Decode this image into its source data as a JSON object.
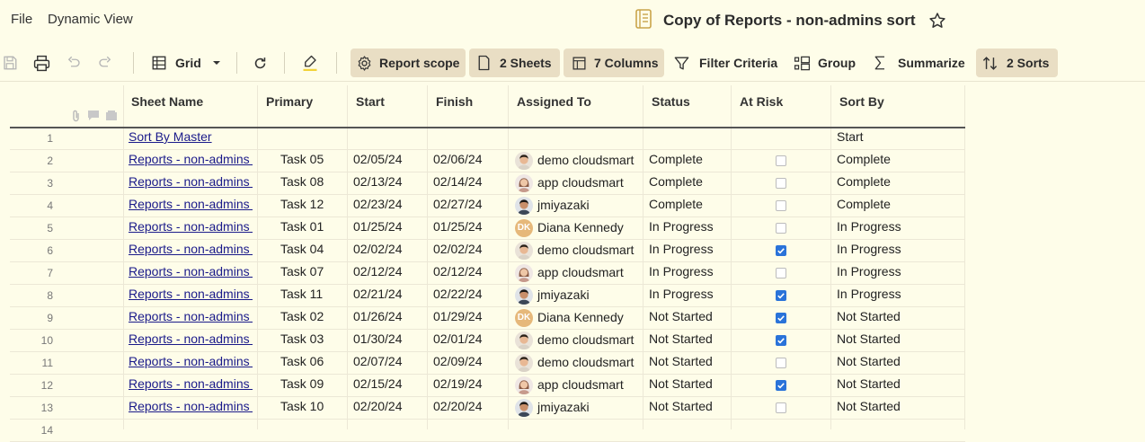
{
  "menu": {
    "file": "File",
    "dynamic_view": "Dynamic View"
  },
  "title": "Copy of Reports - non-admins sort",
  "toolbar": {
    "grid_label": "Grid",
    "report_scope": "Report scope",
    "sheets": "2 Sheets",
    "columns": "7 Columns",
    "filter": "Filter Criteria",
    "group": "Group",
    "summarize": "Summarize",
    "sorts": "2 Sorts"
  },
  "columns": {
    "sheet_name": "Sheet Name",
    "primary": "Primary",
    "start": "Start",
    "finish": "Finish",
    "assigned_to": "Assigned To",
    "status": "Status",
    "at_risk": "At Risk",
    "sort_by": "Sort By"
  },
  "rows": [
    {
      "num": "1",
      "sheet": "Sort By Master",
      "primary": "",
      "start": "",
      "finish": "",
      "assigned": "",
      "avatar": "",
      "status": "",
      "at_risk": null,
      "sort_by": "Start"
    },
    {
      "num": "2",
      "sheet": "Reports - non-admins s",
      "primary": "Task 05",
      "start": "02/05/24",
      "finish": "02/06/24",
      "assigned": "demo cloudsmart",
      "avatar": "man",
      "status": "Complete",
      "at_risk": false,
      "sort_by": "Complete"
    },
    {
      "num": "3",
      "sheet": "Reports - non-admins s",
      "primary": "Task 08",
      "start": "02/13/24",
      "finish": "02/14/24",
      "assigned": "app cloudsmart",
      "avatar": "woman",
      "status": "Complete",
      "at_risk": false,
      "sort_by": "Complete"
    },
    {
      "num": "4",
      "sheet": "Reports - non-admins s",
      "primary": "Task 12",
      "start": "02/23/24",
      "finish": "02/27/24",
      "assigned": "jmiyazaki",
      "avatar": "man-dark",
      "status": "Complete",
      "at_risk": false,
      "sort_by": "Complete"
    },
    {
      "num": "5",
      "sheet": "Reports - non-admins s",
      "primary": "Task 01",
      "start": "01/25/24",
      "finish": "01/25/24",
      "assigned": "Diana Kennedy",
      "avatar": "DK",
      "status": "In Progress",
      "at_risk": false,
      "sort_by": "In Progress"
    },
    {
      "num": "6",
      "sheet": "Reports - non-admins s",
      "primary": "Task 04",
      "start": "02/02/24",
      "finish": "02/02/24",
      "assigned": "demo cloudsmart",
      "avatar": "man",
      "status": "In Progress",
      "at_risk": true,
      "sort_by": "In Progress"
    },
    {
      "num": "7",
      "sheet": "Reports - non-admins s",
      "primary": "Task 07",
      "start": "02/12/24",
      "finish": "02/12/24",
      "assigned": "app cloudsmart",
      "avatar": "woman",
      "status": "In Progress",
      "at_risk": false,
      "sort_by": "In Progress"
    },
    {
      "num": "8",
      "sheet": "Reports - non-admins s",
      "primary": "Task 11",
      "start": "02/21/24",
      "finish": "02/22/24",
      "assigned": "jmiyazaki",
      "avatar": "man-dark",
      "status": "In Progress",
      "at_risk": true,
      "sort_by": "In Progress"
    },
    {
      "num": "9",
      "sheet": "Reports - non-admins s",
      "primary": "Task 02",
      "start": "01/26/24",
      "finish": "01/29/24",
      "assigned": "Diana Kennedy",
      "avatar": "DK",
      "status": "Not Started",
      "at_risk": true,
      "sort_by": "Not Started"
    },
    {
      "num": "10",
      "sheet": "Reports - non-admins s",
      "primary": "Task 03",
      "start": "01/30/24",
      "finish": "02/01/24",
      "assigned": "demo cloudsmart",
      "avatar": "man",
      "status": "Not Started",
      "at_risk": true,
      "sort_by": "Not Started"
    },
    {
      "num": "11",
      "sheet": "Reports - non-admins s",
      "primary": "Task 06",
      "start": "02/07/24",
      "finish": "02/09/24",
      "assigned": "demo cloudsmart",
      "avatar": "man",
      "status": "Not Started",
      "at_risk": false,
      "sort_by": "Not Started"
    },
    {
      "num": "12",
      "sheet": "Reports - non-admins s",
      "primary": "Task 09",
      "start": "02/15/24",
      "finish": "02/19/24",
      "assigned": "app cloudsmart",
      "avatar": "woman",
      "status": "Not Started",
      "at_risk": true,
      "sort_by": "Not Started"
    },
    {
      "num": "13",
      "sheet": "Reports - non-admins s",
      "primary": "Task 10",
      "start": "02/20/24",
      "finish": "02/20/24",
      "assigned": "jmiyazaki",
      "avatar": "man-dark",
      "status": "Not Started",
      "at_risk": false,
      "sort_by": "Not Started"
    },
    {
      "num": "14",
      "sheet": "",
      "primary": "",
      "start": "",
      "finish": "",
      "assigned": "",
      "avatar": "",
      "status": "",
      "at_risk": null,
      "sort_by": ""
    }
  ],
  "colors": {
    "background": "#fefde9",
    "active_button": "#e9dec4",
    "checkbox_checked": "#2a73d9",
    "link": "#1a1a8a"
  }
}
